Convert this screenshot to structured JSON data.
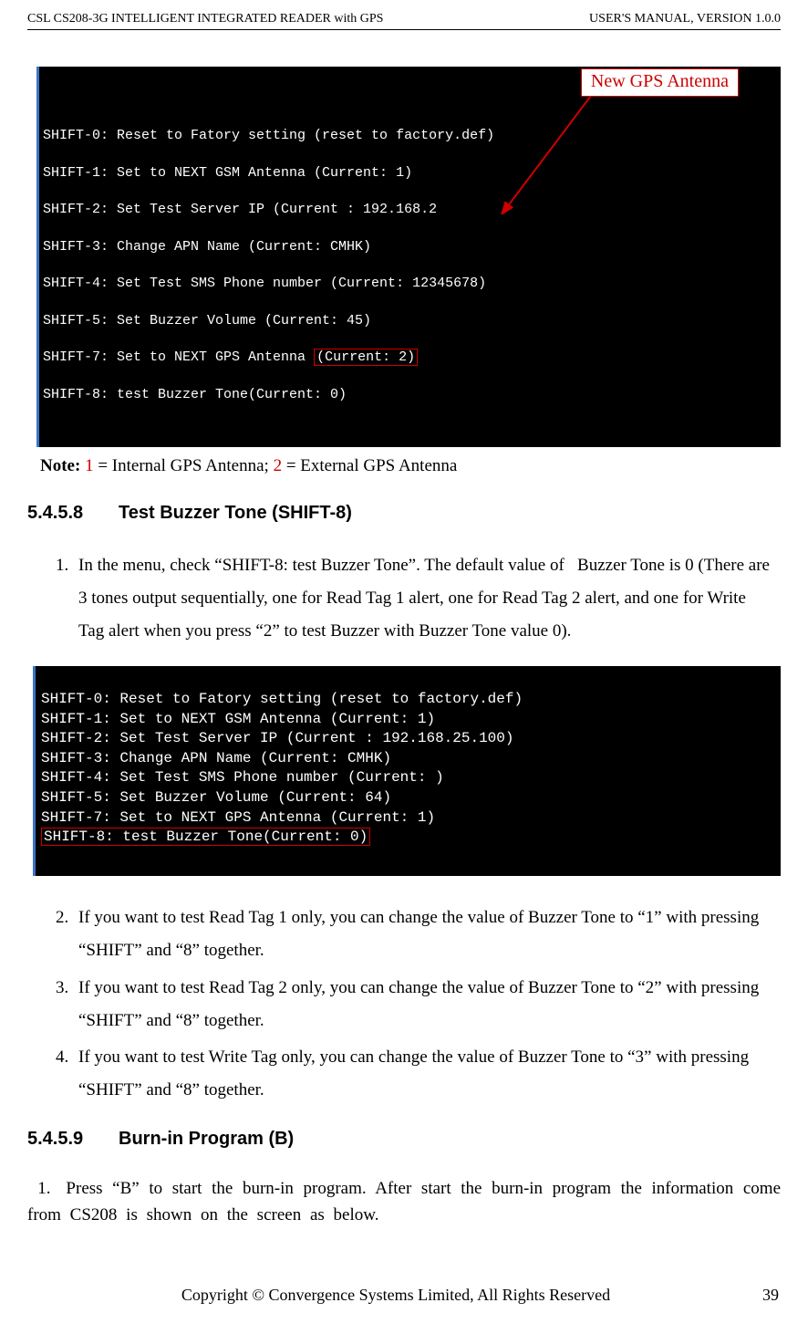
{
  "header": {
    "left": "CSL CS208-3G INTELLIGENT INTEGRATED READER with GPS",
    "right": "USER'S  MANUAL,  VERSION  1.0.0"
  },
  "terminal1": {
    "callout": "New GPS Antenna",
    "lines": [
      "SHIFT-0: Reset to Fatory setting (reset to factory.def)",
      "SHIFT-1: Set to NEXT GSM Antenna (Current: 1)",
      "SHIFT-2: Set Test Server IP (Current : 192.168.2",
      "SHIFT-3: Change APN Name (Current: CMHK)",
      "SHIFT-4: Set Test SMS Phone number (Current: 12345678)",
      "SHIFT-5: Set Buzzer Volume (Current: 45)"
    ],
    "line7_pre": "SHIFT-7: Set to NEXT GPS Antenna ",
    "line7_box": "(Current: 2)",
    "line8": "SHIFT-8: test Buzzer Tone(Current: 0)"
  },
  "note": {
    "label": "Note:",
    "v1": "1",
    "t1": " = Internal GPS Antenna; ",
    "v2": "2",
    "t2": " = External GPS Antenna"
  },
  "section8": {
    "num": "5.4.5.8",
    "title": "Test Buzzer Tone (SHIFT-8)",
    "item1": "In the menu, check “SHIFT-8: test Buzzer Tone”. The default value of   Buzzer Tone is 0 (There are 3 tones output sequentially, one for Read Tag 1 alert, one for Read Tag 2 alert, and one for Write Tag alert when you press “2” to test Buzzer with Buzzer Tone value 0).",
    "item2": "If you want to test Read Tag 1 only, you can change the value of Buzzer Tone to “1” with pressing “SHIFT” and “8” together.",
    "item3": "If you want to test Read Tag 2 only, you can change the value of Buzzer Tone to “2” with pressing “SHIFT” and “8” together.",
    "item4": "If you want to test Write Tag only, you can change the value of Buzzer Tone to “3” with pressing “SHIFT” and “8” together."
  },
  "terminal2": {
    "lines": [
      "SHIFT-0: Reset to Fatory setting (reset to factory.def)",
      "SHIFT-1: Set to NEXT GSM Antenna (Current: 1)",
      "SHIFT-2: Set Test Server IP (Current : 192.168.25.100)",
      "SHIFT-3: Change APN Name (Current: CMHK)",
      "SHIFT-4: Set Test SMS Phone number (Current: )",
      "SHIFT-5: Set Buzzer Volume (Current: 64)",
      "SHIFT-7: Set to NEXT GPS Antenna (Current: 1)"
    ],
    "line8_box": "SHIFT-8: test Buzzer Tone(Current: 0)"
  },
  "section9": {
    "num": "5.4.5.9",
    "title": "Burn-in Program (B)",
    "item1_no": "1.",
    "item1": "Press “B” to start the burn-in program. After start the burn-in program the information come from CS208 is shown on the screen as below."
  },
  "footer": {
    "copyright": "Copyright © Convergence Systems Limited, All Rights Reserved",
    "page": "39"
  }
}
